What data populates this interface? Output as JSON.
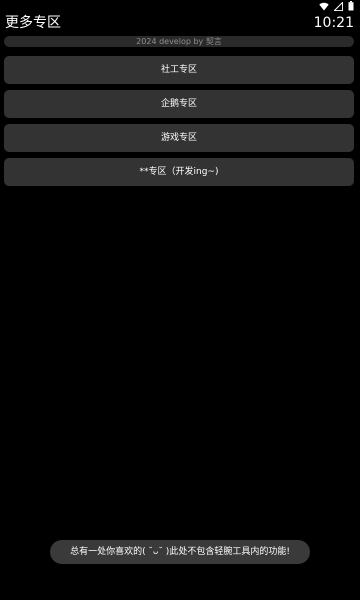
{
  "status_bar": {
    "icons": [
      "wifi-icon",
      "signal-icon",
      "battery-icon"
    ]
  },
  "header": {
    "title": "更多专区",
    "time": "10:21"
  },
  "subtitle": "2024 develop by 契言",
  "menu": {
    "items": [
      {
        "label": "社工专区"
      },
      {
        "label": "企鹅专区"
      },
      {
        "label": "游戏专区"
      },
      {
        "label": "**专区（开发ing~)"
      }
    ]
  },
  "toast": {
    "text": "总有一处你喜欢的( ˘ᴗ˘ )此处不包含轻腕工具内的功能!"
  },
  "colors": {
    "background": "#000000",
    "button": "#333333",
    "subtitle_text": "#8f8f8f",
    "toast_bg": "#3a3a3a"
  }
}
